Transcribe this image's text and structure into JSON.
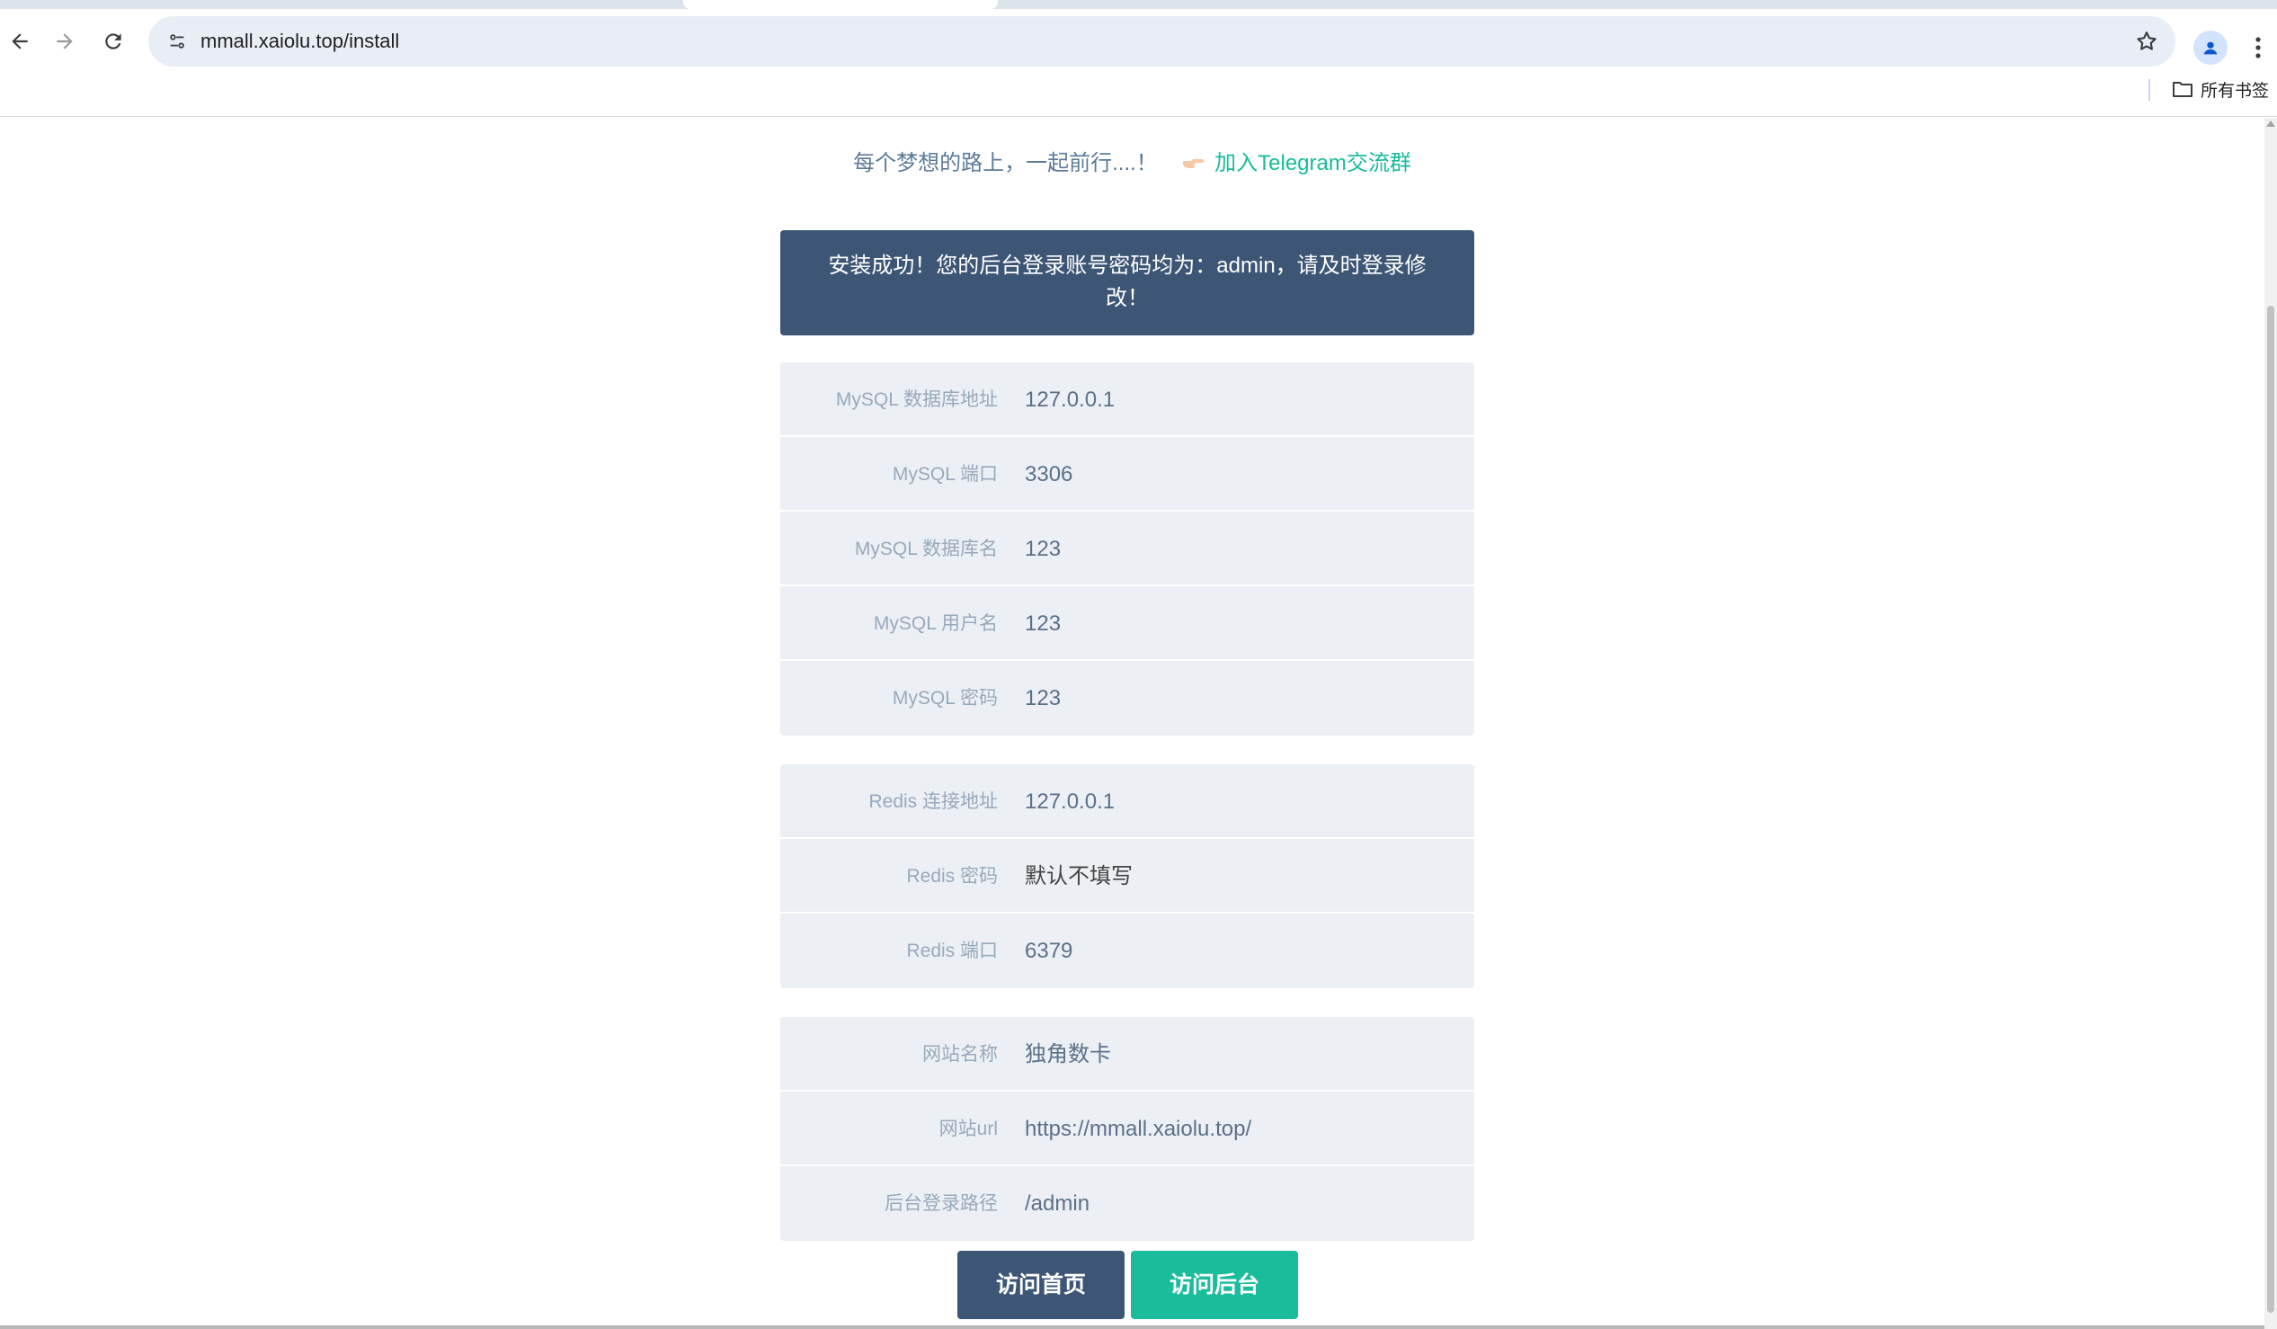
{
  "browser": {
    "url": "mmall.xaiolu.top/install",
    "bookmarks_label": "所有书签"
  },
  "header": {
    "tagline": "每个梦想的路上，一起前行....！",
    "telegram_link": "加入Telegram交流群"
  },
  "alert": {
    "message": "安装成功！您的后台登录账号密码均为：admin，请及时登录修改！"
  },
  "mysql": {
    "rows": [
      {
        "label": "MySQL 数据库地址",
        "value": "127.0.0.1"
      },
      {
        "label": "MySQL 端口",
        "value": "3306"
      },
      {
        "label": "MySQL 数据库名",
        "value": "123"
      },
      {
        "label": "MySQL 用户名",
        "value": "123"
      },
      {
        "label": "MySQL 密码",
        "value": "123"
      }
    ]
  },
  "redis": {
    "rows": [
      {
        "label": "Redis 连接地址",
        "value": "127.0.0.1"
      },
      {
        "label": "Redis 密码",
        "value": "默认不填写"
      },
      {
        "label": "Redis 端口",
        "value": "6379"
      }
    ]
  },
  "site": {
    "rows": [
      {
        "label": "网站名称",
        "value": "独角数卡"
      },
      {
        "label": "网站url",
        "value": "https://mmall.xaiolu.top/"
      },
      {
        "label": "后台登录路径",
        "value": "/admin"
      }
    ]
  },
  "actions": {
    "home_label": "访问首页",
    "admin_label": "访问后台"
  },
  "colors": {
    "primary_dark": "#3d5675",
    "accent_green": "#1abc9c",
    "card_bg": "#ecf0f4"
  }
}
